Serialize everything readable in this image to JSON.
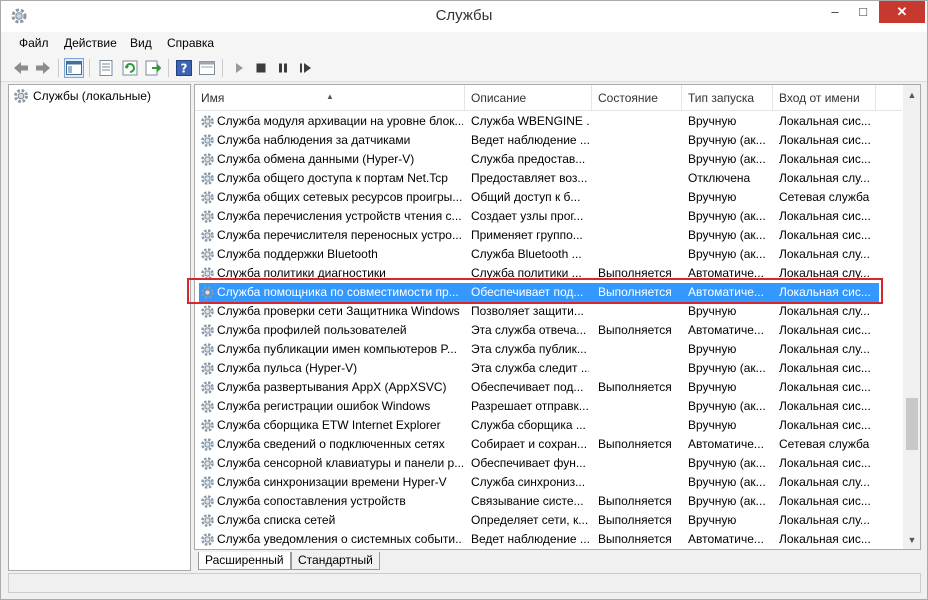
{
  "window": {
    "title": "Службы"
  },
  "title_buttons": {
    "minimize": "–",
    "maximize": "□",
    "close": "✕"
  },
  "menu": [
    "Файл",
    "Действие",
    "Вид",
    "Справка"
  ],
  "toolbar_icons": [
    "back-arrow-icon",
    "forward-arrow-icon",
    "console-tree-icon",
    "properties-icon",
    "refresh-icon",
    "export-list-icon",
    "help-icon",
    "view-icon",
    "play-icon",
    "stop-icon",
    "pause-icon",
    "restart-icon"
  ],
  "tree": {
    "root": "Службы (локальные)"
  },
  "columns": [
    "Имя",
    "Описание",
    "Состояние",
    "Тип запуска",
    "Вход от имени"
  ],
  "rows": [
    {
      "name": "Служба модуля архивации на уровне блок...",
      "desc": "Служба WBENGINE ...",
      "state": "",
      "start": "Вручную",
      "logon": "Локальная сис..."
    },
    {
      "name": "Служба наблюдения за датчиками",
      "desc": "Ведет наблюдение ...",
      "state": "",
      "start": "Вручную (ак...",
      "logon": "Локальная сис..."
    },
    {
      "name": "Служба обмена данными (Hyper-V)",
      "desc": "Служба предостав...",
      "state": "",
      "start": "Вручную (ак...",
      "logon": "Локальная сис..."
    },
    {
      "name": "Служба общего доступа к портам Net.Tcp",
      "desc": "Предоставляет воз...",
      "state": "",
      "start": "Отключена",
      "logon": "Локальная слу..."
    },
    {
      "name": "Служба общих сетевых ресурсов проигры...",
      "desc": "Общий доступ к б...",
      "state": "",
      "start": "Вручную",
      "logon": "Сетевая служба"
    },
    {
      "name": "Служба перечисления устройств чтения с...",
      "desc": "Создает узлы прог...",
      "state": "",
      "start": "Вручную (ак...",
      "logon": "Локальная сис..."
    },
    {
      "name": "Служба перечислителя переносных устро...",
      "desc": "Применяет группо...",
      "state": "",
      "start": "Вручную (ак...",
      "logon": "Локальная сис..."
    },
    {
      "name": "Служба поддержки Bluetooth",
      "desc": "Служба Bluetooth ...",
      "state": "",
      "start": "Вручную (ак...",
      "logon": "Локальная слу..."
    },
    {
      "name": "Служба политики диагностики",
      "desc": "Служба политики ...",
      "state": "Выполняется",
      "start": "Автоматиче...",
      "logon": "Локальная слу..."
    },
    {
      "name": "Служба помощника по совместимости пр...",
      "desc": "Обеспечивает под...",
      "state": "Выполняется",
      "start": "Автоматиче...",
      "logon": "Локальная сис...",
      "selected": true
    },
    {
      "name": "Служба проверки сети Защитника Windows",
      "desc": "Позволяет защити...",
      "state": "",
      "start": "Вручную",
      "logon": "Локальная слу..."
    },
    {
      "name": "Служба профилей пользователей",
      "desc": "Эта служба отвеча...",
      "state": "Выполняется",
      "start": "Автоматиче...",
      "logon": "Локальная сис..."
    },
    {
      "name": "Служба публикации имен компьютеров P...",
      "desc": "Эта служба публик...",
      "state": "",
      "start": "Вручную",
      "logon": "Локальная слу..."
    },
    {
      "name": "Служба пульса (Hyper-V)",
      "desc": "Эта служба следит ...",
      "state": "",
      "start": "Вручную (ак...",
      "logon": "Локальная сис..."
    },
    {
      "name": "Служба развертывания AppX (AppXSVC)",
      "desc": "Обеспечивает под...",
      "state": "Выполняется",
      "start": "Вручную",
      "logon": "Локальная сис..."
    },
    {
      "name": "Служба регистрации ошибок Windows",
      "desc": "Разрешает отправк...",
      "state": "",
      "start": "Вручную (ак...",
      "logon": "Локальная сис..."
    },
    {
      "name": "Служба сборщика ETW Internet Explorer",
      "desc": "Служба сборщика ...",
      "state": "",
      "start": "Вручную",
      "logon": "Локальная сис..."
    },
    {
      "name": "Служба сведений о подключенных сетях",
      "desc": "Собирает и сохран...",
      "state": "Выполняется",
      "start": "Автоматиче...",
      "logon": "Сетевая служба"
    },
    {
      "name": "Служба сенсорной клавиатуры и панели р...",
      "desc": "Обеспечивает фун...",
      "state": "",
      "start": "Вручную (ак...",
      "logon": "Локальная сис..."
    },
    {
      "name": "Служба синхронизации времени Hyper-V",
      "desc": "Служба синхрониз...",
      "state": "",
      "start": "Вручную (ак...",
      "logon": "Локальная слу..."
    },
    {
      "name": "Служба сопоставления устройств",
      "desc": "Связывание систе...",
      "state": "Выполняется",
      "start": "Вручную (ак...",
      "logon": "Локальная сис..."
    },
    {
      "name": "Служба списка сетей",
      "desc": "Определяет сети, к...",
      "state": "Выполняется",
      "start": "Вручную",
      "logon": "Локальная слу..."
    },
    {
      "name": "Служба уведомления о системных событи...",
      "desc": "Ведет наблюдение ...",
      "state": "Выполняется",
      "start": "Автоматиче...",
      "logon": "Локальная сис..."
    }
  ],
  "tabs": [
    "Расширенный",
    "Стандартный"
  ],
  "colors": {
    "selection": "#3399ff",
    "highlight_border": "#d9262e",
    "close_button": "#c7382e"
  }
}
